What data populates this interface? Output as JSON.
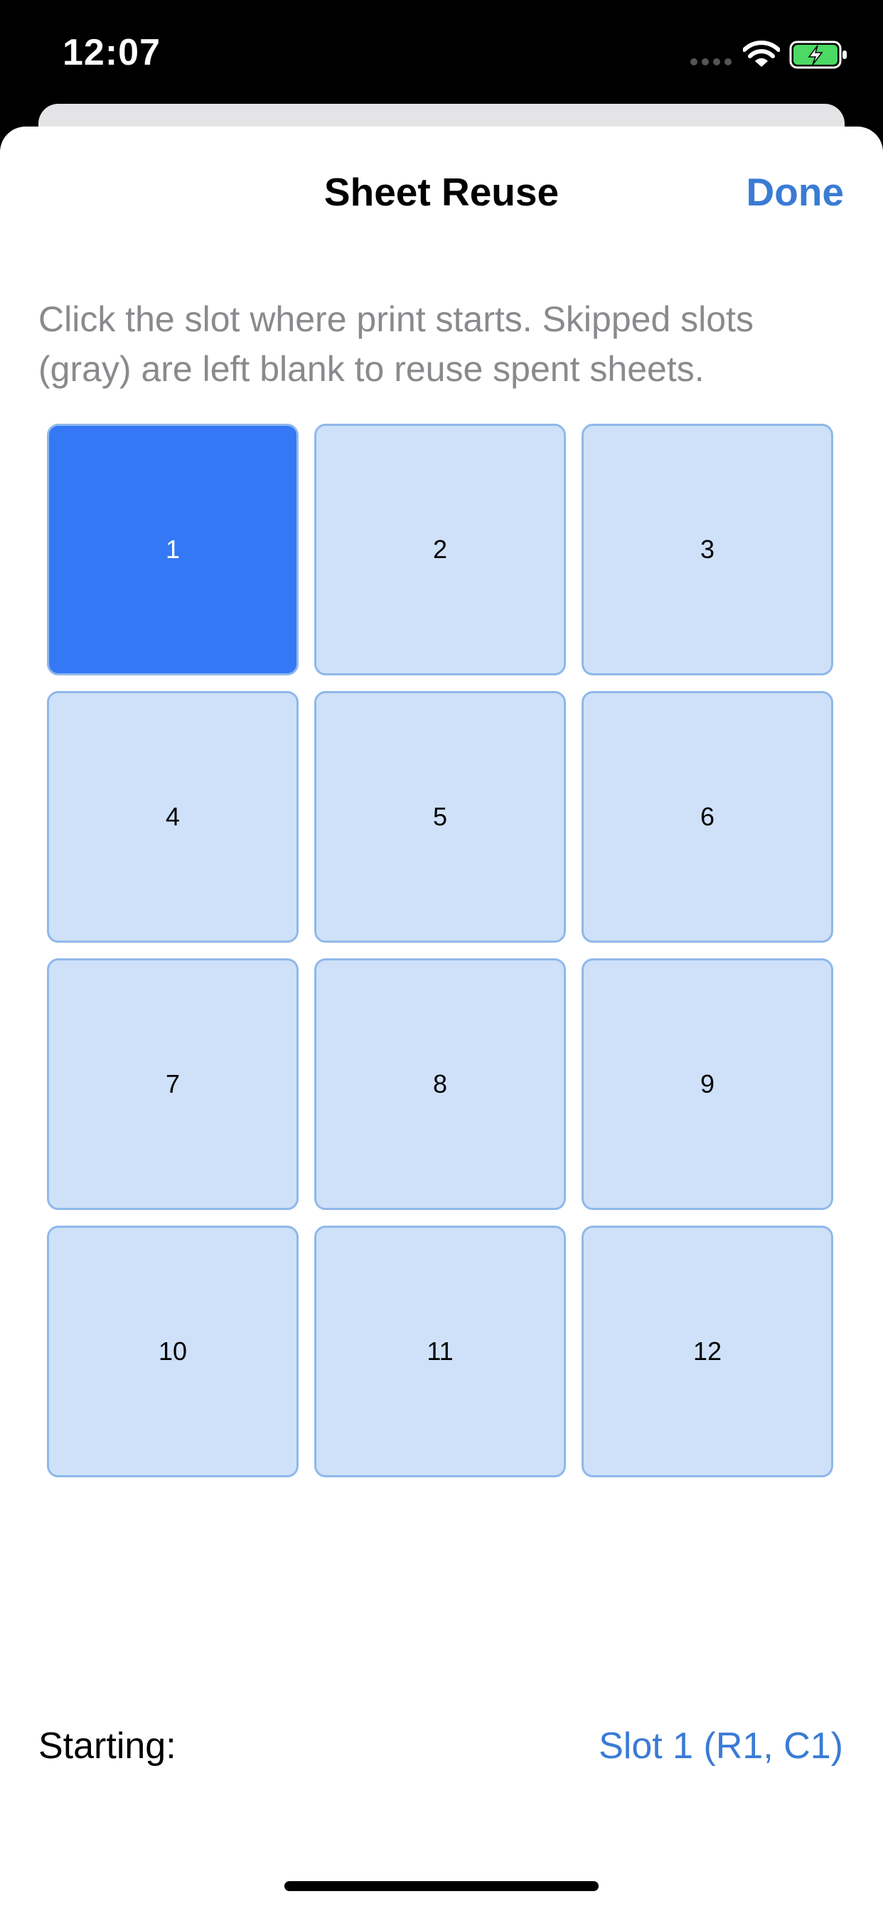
{
  "status_bar": {
    "time": "12:07",
    "signal_icon": "signal-dots-icon",
    "wifi_icon": "wifi-icon",
    "battery_icon": "battery-charging-icon",
    "battery_color": "#4cd964"
  },
  "sheet": {
    "title": "Sheet Reuse",
    "done_label": "Done",
    "instructions": "Click the slot where print starts. Skipped slots (gray) are left blank to reuse spent sheets.",
    "slots": [
      {
        "label": "1",
        "selected": true
      },
      {
        "label": "2",
        "selected": false
      },
      {
        "label": "3",
        "selected": false
      },
      {
        "label": "4",
        "selected": false
      },
      {
        "label": "5",
        "selected": false
      },
      {
        "label": "6",
        "selected": false
      },
      {
        "label": "7",
        "selected": false
      },
      {
        "label": "8",
        "selected": false
      },
      {
        "label": "9",
        "selected": false
      },
      {
        "label": "10",
        "selected": false
      },
      {
        "label": "11",
        "selected": false
      },
      {
        "label": "12",
        "selected": false
      }
    ],
    "starting_label": "Starting:",
    "starting_value": "Slot 1 (R1, C1)"
  },
  "colors": {
    "accent": "#3a7bd5",
    "selected_slot": "#3478f6",
    "slot_fill": "#cfe1f8",
    "slot_border": "#8fb8ea"
  }
}
